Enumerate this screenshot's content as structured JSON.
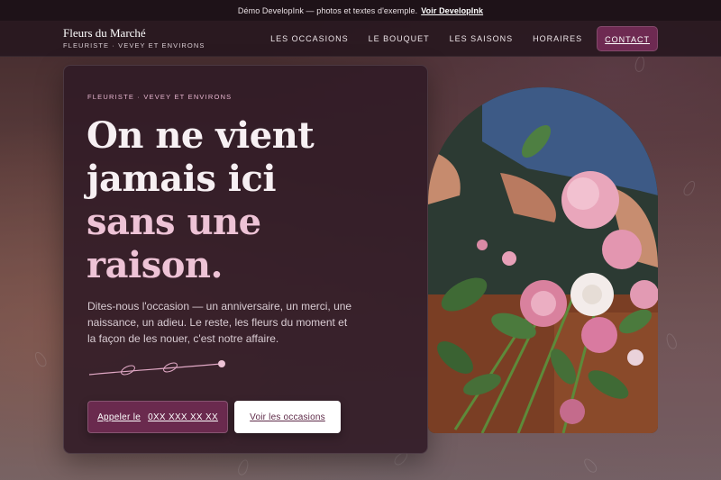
{
  "demo_bar": {
    "text": "Démo DevelopInk — photos et textes d'exemple.",
    "link_label": "Voir DevelopInk"
  },
  "header": {
    "brand_name": "Fleurs du Marché",
    "brand_tagline": "FLEURISTE · VEVEY ET ENVIRONS",
    "nav": [
      {
        "label": "LES OCCASIONS"
      },
      {
        "label": "LE BOUQUET"
      },
      {
        "label": "LES SAISONS"
      },
      {
        "label": "HORAIRES"
      }
    ],
    "cta_label": "CONTACT"
  },
  "hero": {
    "eyebrow": "FLEURISTE · VEVEY ET ENVIRONS",
    "headline_part1": "On ne vient jamais ici",
    "headline_accent": "sans une raison.",
    "lede": "Dites-nous l'occasion — un anniversaire, un merci, une naissance, un adieu. Le reste, les fleurs du moment et la façon de les nouer, c'est notre affaire.",
    "call_button": {
      "label": "Appeler le",
      "phone": "0XX XXX XX XX"
    },
    "occasions_button": "Voir les occasions"
  },
  "colors": {
    "accent": "#6e2a52",
    "accent_light": "#eec3d6",
    "card_bg": "#301a26"
  },
  "icons": [
    "vine-flourish-icon",
    "flower-arch-photo"
  ]
}
